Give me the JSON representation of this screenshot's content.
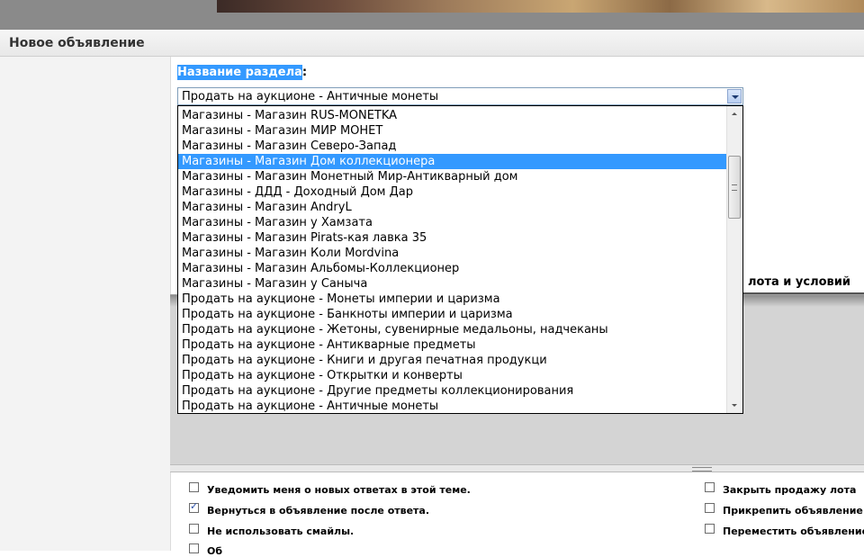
{
  "header": {
    "title": "Новое объявление"
  },
  "section": {
    "label_highlight": "Название раздела",
    "label_suffix": ":",
    "selected_value": "Продать на аукционе - Античные монеты"
  },
  "dropdown": {
    "items": [
      "Магазины - Магазин RUS-MONETKA",
      "Магазины - Магазин МИР МОНЕТ",
      "Магазины - Магазин Северо-Запад",
      "Магазины - Магазин Дом коллекционера",
      "Магазины - Магазин Монетный Мир-Антикварный дом",
      "Магазины - ДДД - Доходный Дом Дар",
      "Магазины - Магазин AndryL",
      "Магазины - Магазин у Хамзата",
      "Магазины - Магазин Pirats-кая лавка 35",
      "Магазины - Магазин Коли Mordvina",
      "Магазины - Магазин Альбомы-Коллекционер",
      "Магазины - Магазин у Саныча",
      "Продать на аукционе - Монеты империи и царизма",
      "Продать на аукционе - Банкноты империи и царизма",
      "Продать на аукционе - Жетоны, сувенирные медальоны, надчеканы",
      "Продать на аукционе - Антикварные предметы",
      "Продать на аукционе - Книги и другая печатная продукци",
      "Продать на аукционе - Открытки и конверты",
      "Продать на аукционе - Другие предметы коллекционирования",
      "Продать на аукционе - Античные монеты"
    ],
    "highlighted_index": 3
  },
  "lot_label": "лота и условий",
  "options": {
    "notify": {
      "label": "Уведомить меня о новых ответах в этой теме.",
      "checked": false
    },
    "return": {
      "label": "Вернуться в объявление после ответа.",
      "checked": true
    },
    "no_smileys": {
      "label": "Не использовать смайлы.",
      "checked": false
    },
    "partial": {
      "label": "Об",
      "checked": false
    },
    "close_sale": {
      "label": "Закрыть продажу лота",
      "checked": false
    },
    "pin": {
      "label": "Прикрепить объявление",
      "checked": false
    },
    "move": {
      "label": "Переместить объявление",
      "checked": false
    }
  }
}
